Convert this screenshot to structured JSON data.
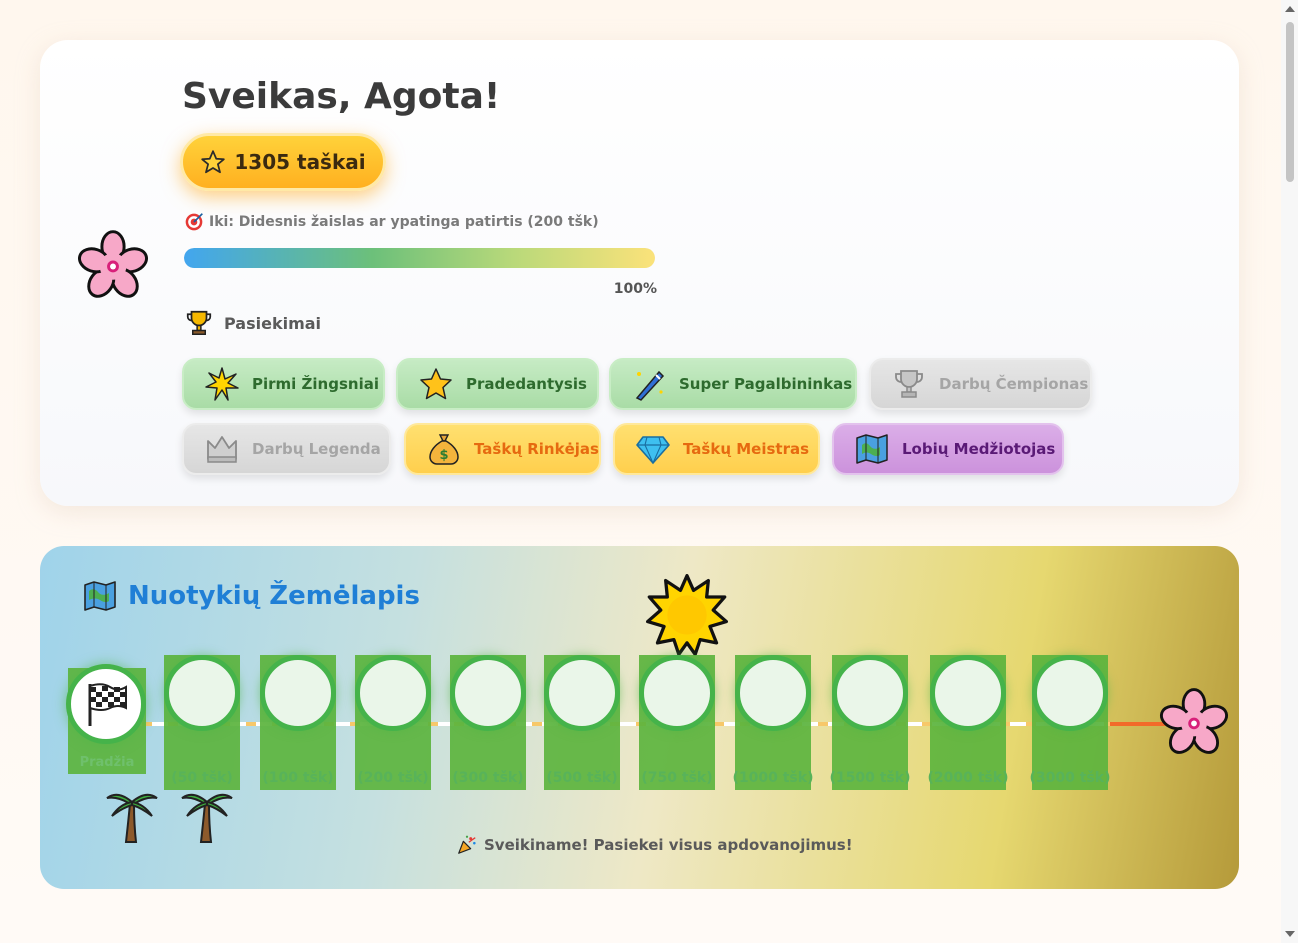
{
  "profile": {
    "greeting": "Sveikas, Agota!",
    "points_label": "1305 taškai",
    "goal_text": "Iki: Didesnis žaislas ar ypatinga patirtis (200 tšk)",
    "progress_percent": 100,
    "progress_label": "100%",
    "achievements_title": "Pasiekimai",
    "achievements": [
      {
        "label": "Pirmi Žingsniai",
        "icon": "sparkle-star-icon",
        "state": "earned-green"
      },
      {
        "label": "Pradedantysis",
        "icon": "star-icon",
        "state": "earned-green"
      },
      {
        "label": "Super Pagalbininkas",
        "icon": "magic-wand-icon",
        "state": "earned-green"
      },
      {
        "label": "Darbų Čempionas",
        "icon": "trophy-icon",
        "state": "locked"
      },
      {
        "label": "Darbų Legenda",
        "icon": "crown-icon",
        "state": "locked"
      },
      {
        "label": "Taškų Rinkėjas",
        "icon": "money-bag-icon",
        "state": "earned-gold"
      },
      {
        "label": "Taškų Meistras",
        "icon": "diamond-icon",
        "state": "earned-gold"
      },
      {
        "label": "Lobių Medžiotojas",
        "icon": "treasure-map-icon",
        "state": "earned-purple"
      }
    ]
  },
  "adventure_map": {
    "title": "Nuotykių Žemėlapis",
    "start_label": "Pradžia",
    "milestones": [
      "(50 tšk)",
      "(100 tšk)",
      "(200 tšk)",
      "(300 tšk)",
      "(500 tšk)",
      "(750 tšk)",
      "(1000 tšk)",
      "(1500 tšk)",
      "(2000 tšk)",
      "(3000 tšk)"
    ],
    "congrats_text": "Sveikiname! Pasiekei visus apdovanojimus!"
  },
  "colors": {
    "accent_gold": "#ffb020",
    "map_blue": "#1f7fd6",
    "node_green": "#45b34a"
  }
}
